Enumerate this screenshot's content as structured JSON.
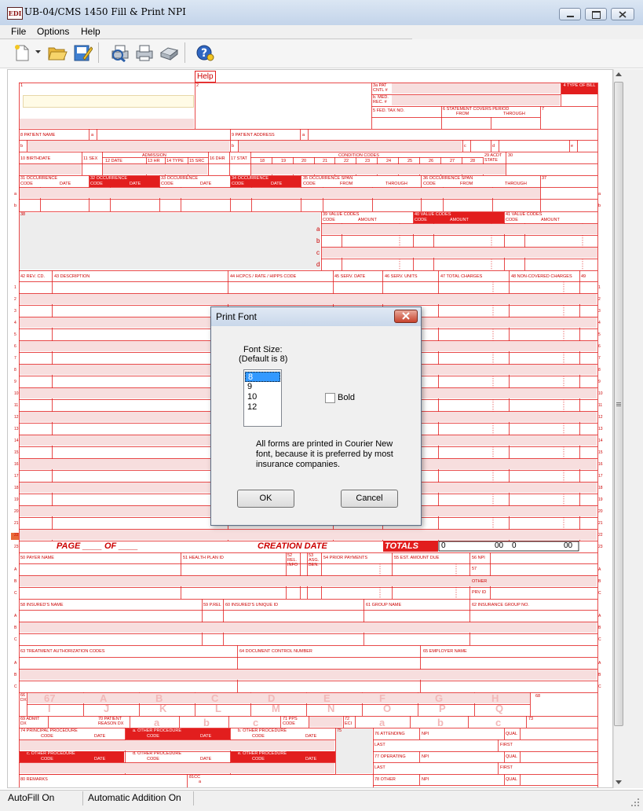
{
  "window": {
    "title": "UB-04/CMS 1450 Fill & Print NPI",
    "icon_text": "EDI"
  },
  "menu": [
    "File",
    "Options",
    "Help"
  ],
  "toolbar": {
    "icons": [
      "new-file-icon",
      "dropdown-arrow-icon",
      "open-folder-icon",
      "save-edit-icon",
      "print-preview-icon",
      "print-icon",
      "print-batch-icon",
      "help-icon"
    ]
  },
  "form": {
    "help_label": "Help",
    "f1": "1",
    "f2": "2",
    "f3a": "3a PAT CNTL #",
    "f3b": "b. MED. REC. #",
    "f4": "4  TYPE OF BILL",
    "f5": "5 FED. TAX NO.",
    "f6": "6   STATEMENT COVERS PERIOD",
    "f6_from": "FROM",
    "f6_through": "THROUGH",
    "f7": "7",
    "f8": "8 PATIENT  NAME",
    "a": "a",
    "b": "b",
    "c": "c",
    "d": "d",
    "e": "e",
    "f9": "9 PATIENT  ADDRESS",
    "f10": "10 BIRTHDATE",
    "f11": "11 SEX",
    "admission": "ADMISSION",
    "f12": "12   DATE",
    "f13": "13 HR",
    "f14": "14 TYPE",
    "f15": "15 SRC",
    "f16": "16 DHR",
    "f17": "17 STAT",
    "condition_codes": "CONDITION CODES",
    "cond_nums": [
      "18",
      "19",
      "20",
      "21",
      "22",
      "23",
      "24",
      "25",
      "26",
      "27",
      "28"
    ],
    "f29": "29 ACDT STATE",
    "f30": "30",
    "occ_code": "CODE",
    "occ_date": "DATE",
    "f31": "31     OCCURRENCE",
    "f32": "32     OCCURRENCE",
    "f33": "33     OCCURRENCE",
    "f34": "34     OCCURRENCE",
    "f35": "35        OCCURRENCE SPAN",
    "f36": "36        OCCURRENCE SPAN",
    "span_from": "FROM",
    "span_through": "THROUGH",
    "f37": "37",
    "f38": "38",
    "f39": "39       VALUE CODES",
    "f40": "40       VALUE CODES",
    "f41": "41       VALUE CODES",
    "amount": "AMOUNT",
    "vc_rows": [
      "a",
      "b",
      "c",
      "d"
    ],
    "f42": "42 REV. CD.",
    "f43": "43 DESCRIPTION",
    "f44": "44 HCPCS / RATE / HIPPS CODE",
    "f45": "45 SERV. DATE",
    "f46": "46 SERV. UNITS",
    "f47": "47 TOTAL CHARGES",
    "f48": "48 NON-COVERED CHARGES",
    "f49": "49",
    "line_nums": [
      "1",
      "2",
      "3",
      "4",
      "5",
      "6",
      "7",
      "8",
      "9",
      "10",
      "11",
      "12",
      "13",
      "14",
      "15",
      "16",
      "17",
      "18",
      "19",
      "20",
      "21",
      "22",
      "23"
    ],
    "page_label": "PAGE ____   OF ____",
    "creation_date": "CREATION DATE",
    "totals": "TOTALS",
    "total_val": "0",
    "total_cents": "00",
    "noncov_val": "0",
    "noncov_cents": "00",
    "f50": "50 PAYER  NAME",
    "f51": "51 HEALTH PLAN ID",
    "f52": "52 REL. INFO",
    "f53": "53 ASG. BEN.",
    "f54": "54 PRIOR PAYMENTS",
    "f55": "55 EST. AMOUNT DUE",
    "f56": "56 NPI",
    "f57": "57",
    "other": "OTHER",
    "prv_id": "PRV ID",
    "abc": [
      "A",
      "B",
      "C"
    ],
    "f58": "58 INSURED'S NAME",
    "f59": "59 P.REL",
    "f60": "60 INSURED'S UNIQUE ID",
    "f61": "61 GROUP NAME",
    "f62": "62 INSURANCE GROUP NO.",
    "f63": "63 TREATMENT AUTHORIZATION CODES",
    "f64": "64 DOCUMENT CONTROL NUMBER",
    "f65": "65 EMPLOYER NAME",
    "f66": "66 DX",
    "dx_top": [
      "67",
      "A",
      "B",
      "C",
      "D",
      "E",
      "F",
      "G",
      "H"
    ],
    "dx_bot": [
      "I",
      "J",
      "K",
      "L",
      "M",
      "N",
      "O",
      "P",
      "Q"
    ],
    "f68": "68",
    "f69": "69 ADMIT DX",
    "f70": "70 PATIENT REASON DX",
    "reason": [
      "a",
      "b",
      "c"
    ],
    "f71": "71 PPS CODE",
    "f72": "72 ECI",
    "eci": [
      "a",
      "b",
      "c"
    ],
    "f73": "73",
    "f74": "74        PRINCIPAL PROCEDURE",
    "other_proc": "OTHER PROCEDURE",
    "proc_code": "CODE",
    "proc_date": "DATE",
    "f75": "75",
    "f76": "76 ATTENDING",
    "f77": "77 OPERATING",
    "f78": "78 OTHER",
    "npi": "NPI",
    "qual": "QUAL",
    "last": "LAST",
    "first": "FIRST",
    "f80": "80 REMARKS",
    "f81": "81CC"
  },
  "dialog": {
    "title": "Print Font",
    "font_size_label": "Font Size:",
    "default_label": "(Default is 8)",
    "sizes": [
      "8",
      "9",
      "10",
      "12"
    ],
    "selected_size": "8",
    "bold_label": "Bold",
    "note_line1": "All forms are printed in Courier New",
    "note_line2": "font, because it is preferred by most",
    "note_line3": "insurance companies.",
    "ok": "OK",
    "cancel": "Cancel"
  },
  "status": {
    "autofill": "AutoFill On",
    "auto_addition": "Automatic Addition On"
  },
  "colors": {
    "form_red": "#e21e1e",
    "row_tint": "#f7dede",
    "selection": "#3399ff"
  }
}
